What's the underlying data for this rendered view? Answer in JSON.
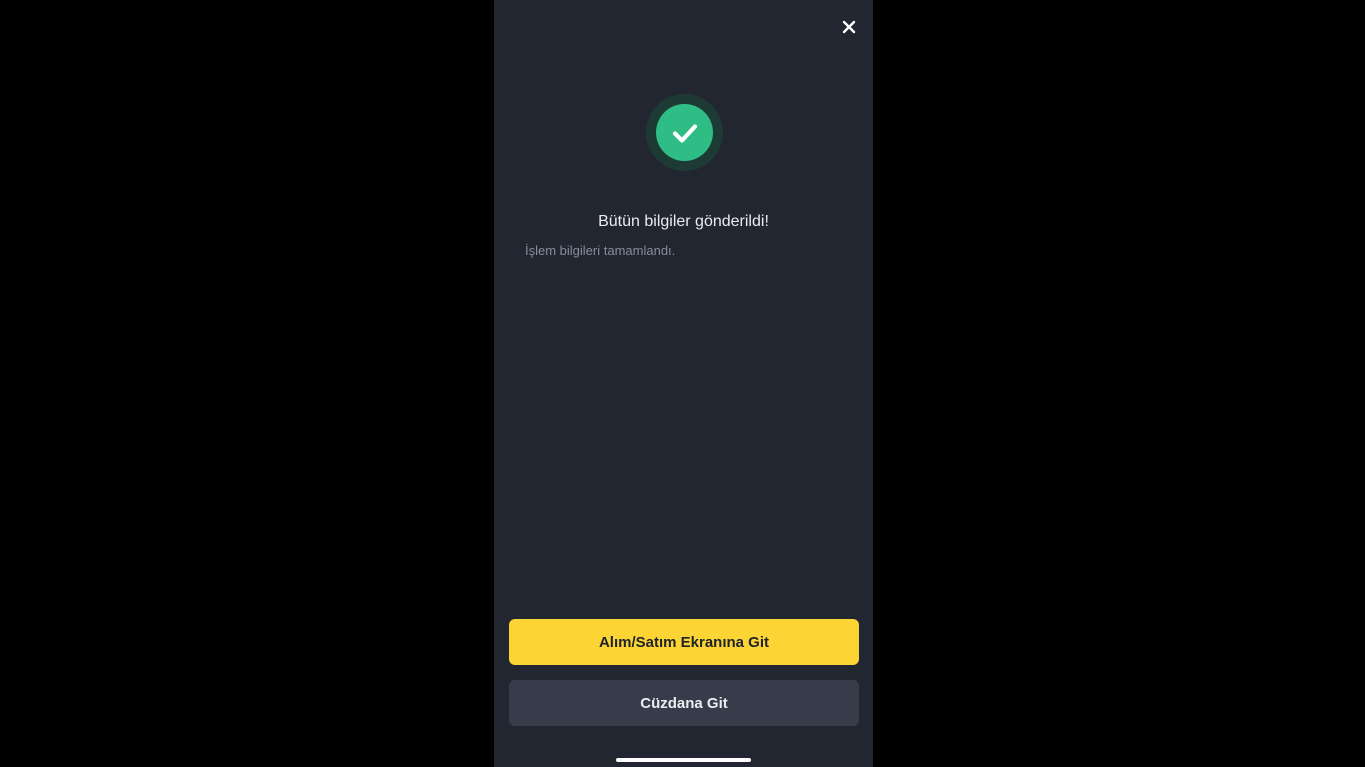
{
  "screen": {
    "close_icon": "close-icon",
    "success_icon": "check-circle-icon",
    "title": "Bütün bilgiler gönderildi!",
    "subtitle": "İşlem bilgileri tamamlandı."
  },
  "actions": {
    "primary_label": "Alım/Satım Ekranına Git",
    "secondary_label": "Cüzdana Git"
  },
  "colors": {
    "background": "#222630",
    "success": "#2ebd85",
    "primary_button": "#fcd535",
    "secondary_button": "#373c4a"
  }
}
